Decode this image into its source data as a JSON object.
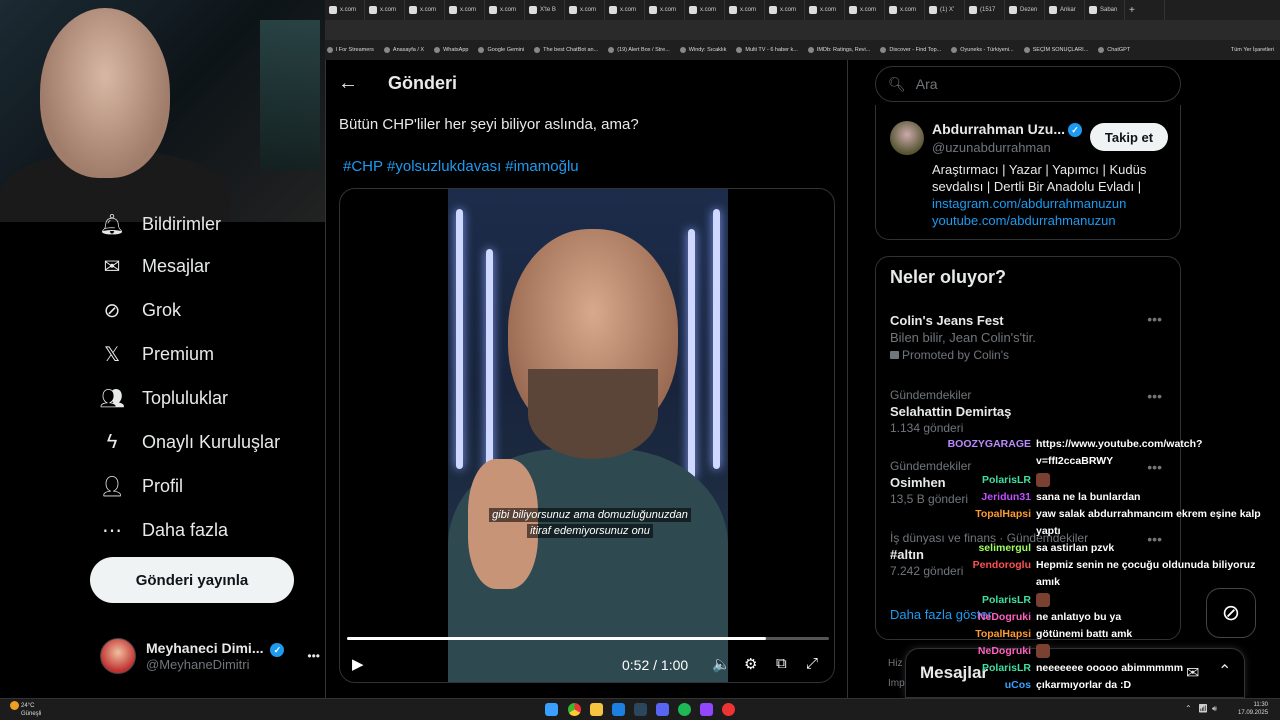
{
  "browser": {
    "tabs": [
      "x.com",
      "x.com",
      "x.com",
      "x.com",
      "x.com",
      "X'te B",
      "x.com",
      "x.com",
      "x.com",
      "x.com",
      "x.com",
      "x.com",
      "x.com",
      "x.com",
      "x.com",
      "(1) X'",
      "(1517",
      "Dezen",
      "Ankar",
      "Saban"
    ],
    "new_tab": "+",
    "bookmarks": [
      "l For Streamers",
      "Anasayfa / X",
      "WhatsApp",
      "Google Gemini",
      "The best ChatBot an...",
      "(19) Alert Box / Stre...",
      "Windy: Sıcaklık",
      "Multi TV - 6 haber k...",
      "IMDb: Ratings, Revi...",
      "Discover - Find Top...",
      "Oyuneks - Türkiyeni...",
      "SEÇİM SONUÇLARI...",
      "ChatGPT"
    ],
    "all_bookmarks": "Tüm Yer İşaretleri"
  },
  "nav": {
    "items": [
      {
        "label": "Bildirimler",
        "icon": "bell-icon"
      },
      {
        "label": "Mesajlar",
        "icon": "mail-icon"
      },
      {
        "label": "Grok",
        "icon": "grok-icon"
      },
      {
        "label": "Premium",
        "icon": "x-logo-icon"
      },
      {
        "label": "Topluluklar",
        "icon": "people-icon"
      },
      {
        "label": "Onaylı Kuruluşlar",
        "icon": "bolt-icon"
      },
      {
        "label": "Profil",
        "icon": "person-icon"
      },
      {
        "label": "Daha fazla",
        "icon": "more-circle-icon"
      }
    ],
    "post_button": "Gönderi yayınla",
    "account": {
      "name": "Meyhaneci Dimi...",
      "handle": "@MeyhaneDimitri",
      "more": "•••"
    }
  },
  "main": {
    "header_title": "Gönderi",
    "post_text": "Bütün CHP'liler her şeyi biliyor aslında, ama?",
    "hashtags": [
      "#CHP",
      "#yolsuzlukdavası",
      "#imamoğlu"
    ],
    "video": {
      "subtitle_line1": "gibi biliyorsunuz ama domuzluğunuzdan",
      "subtitle_line2": "itiraf edemiyorsunuz onu",
      "time": "0:52 / 1:00",
      "progress": 0.87
    }
  },
  "right": {
    "search_placeholder": "Ara",
    "profile": {
      "name": "Abdurrahman Uzu...",
      "handle": "@uzunabdurrahman",
      "follow": "Takip et",
      "bio_line1": "Araştırmacı | Yazar | Yapımcı | Kudüs",
      "bio_line2": "sevdalısı | Dertli Bir Anadolu Evladı |",
      "link1": "instagram.com/abdurrahmanuzun",
      "link2": "youtube.com/abdurrahmanuzun"
    },
    "trends_title": "Neler oluyor?",
    "trends": [
      {
        "meta": "",
        "name": "Colin's Jeans Fest",
        "sub": "Bilen bilir, Jean Colin's'tir.",
        "count": "Promoted by Colin's"
      },
      {
        "meta": "Gündemdekiler",
        "name": "Selahattin Demirtaş",
        "sub": "",
        "count": "1.134 gönderi"
      },
      {
        "meta": "Gündemdekiler",
        "name": "Osimhen",
        "sub": "",
        "count": "13,5 B gönderi"
      },
      {
        "meta": "İş dünyası ve finans · Gündemdekiler",
        "name": "#altın",
        "sub": "",
        "count": "7.242 gönderi"
      }
    ],
    "show_more": "Daha fazla göster",
    "peek_1": "Hiz",
    "peek_2": "Imp",
    "messages_title": "Mesajlar"
  },
  "chat": [
    {
      "user": "BOOZYGARAGE",
      "color": "#b98bff",
      "msg": "https://www.youtube.com/watch?v=ffI2ccaBRWY"
    },
    {
      "user": "PolarisLR",
      "color": "#3ee0a0",
      "msg": ""
    },
    {
      "user": "Jeridun31",
      "color": "#c050ff",
      "msg": "sana ne la bunlardan"
    },
    {
      "user": "TopalHapsi",
      "color": "#ff9a30",
      "msg": "yaw salak abdurrahmancım ekrem eşine kalp yaptı"
    },
    {
      "user": "selimergul",
      "color": "#9eff60",
      "msg": "sa astirlan pzvk"
    },
    {
      "user": "Pendoroglu",
      "color": "#ff5050",
      "msg": "Hepmiz senin ne çocuğu oldunuda biliyoruz amık"
    },
    {
      "user": "PolarisLR",
      "color": "#3ee0a0",
      "msg": ""
    },
    {
      "user": "NeDogruki",
      "color": "#ff60c0",
      "msg": "ne anlatıyo bu ya"
    },
    {
      "user": "TopalHapsi",
      "color": "#ff9a30",
      "msg": "götünemi battı amk"
    },
    {
      "user": "NeDogruki",
      "color": "#ff60c0",
      "msg": ""
    },
    {
      "user": "PolarisLR",
      "color": "#3ee0a0",
      "msg": "neeeeeee ooooo abimmmmm"
    },
    {
      "user": "uCos",
      "color": "#3aa0ff",
      "msg": "çıkarmıyorlar da :D"
    }
  ],
  "taskbar": {
    "temp": "24°C",
    "weather": "Güneşli",
    "time": "11:30",
    "date": "17.09.2025"
  }
}
